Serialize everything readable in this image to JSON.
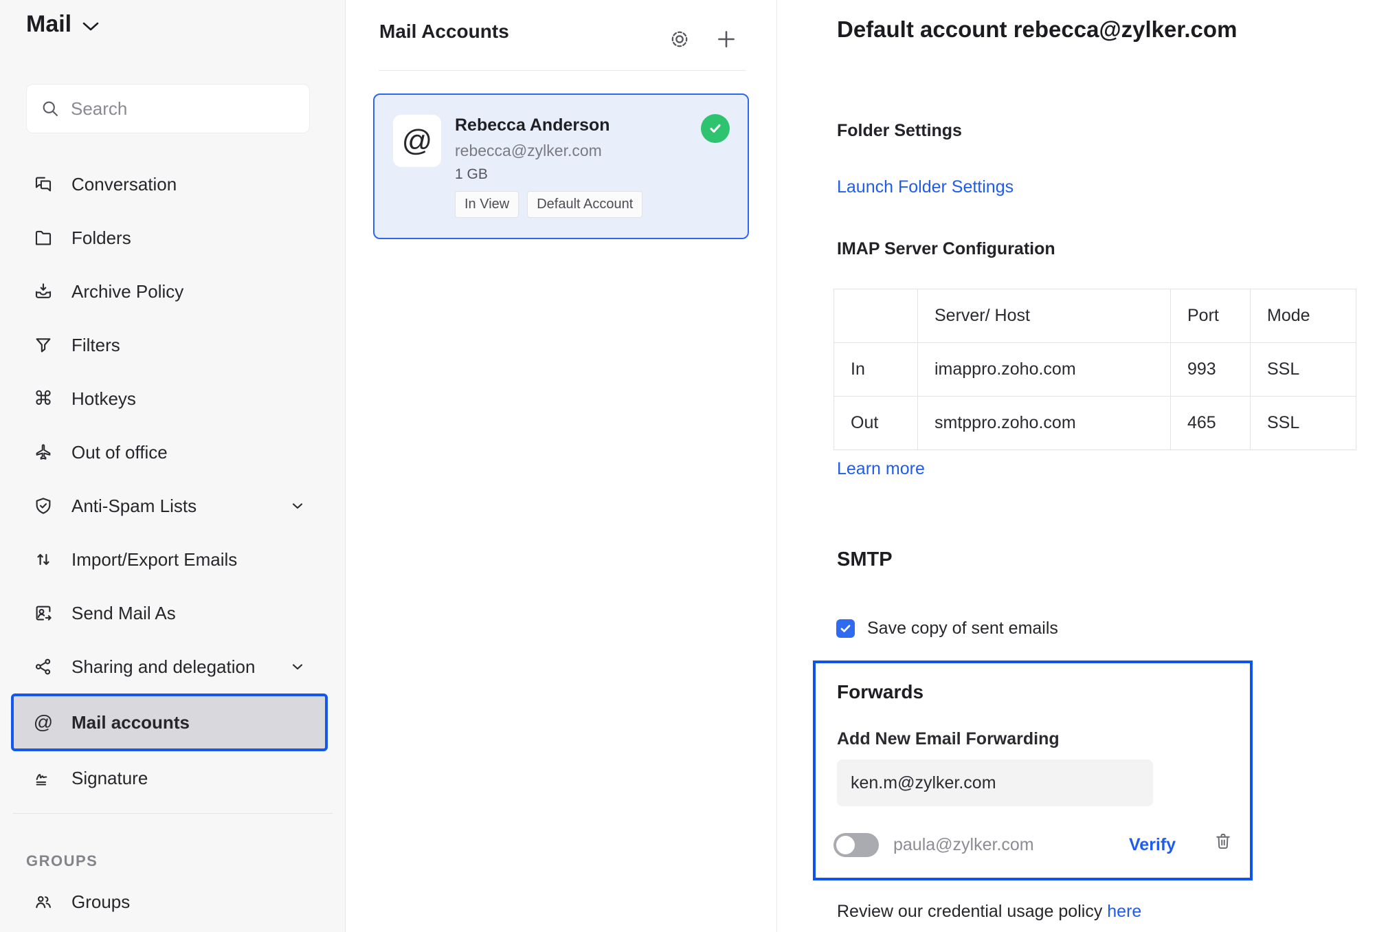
{
  "colors": {
    "accent_blue": "#1f5cec",
    "outline_blue": "#0e53ee",
    "card_border_blue": "#2e66f0",
    "success_green": "#2ec46f",
    "sidebar_bg": "#f7f7f8",
    "selected_item_bg": "#d9d9dd",
    "input_bg": "#f3f3f4"
  },
  "icons": {
    "command_glyph": "⌘",
    "at_glyph": "@"
  },
  "sidebar": {
    "app_title": "Mail",
    "search_placeholder": "Search",
    "items": [
      {
        "label": "Conversation",
        "icon": "chat-icon"
      },
      {
        "label": "Folders",
        "icon": "folder-icon"
      },
      {
        "label": "Archive Policy",
        "icon": "archive-icon"
      },
      {
        "label": "Filters",
        "icon": "funnel-icon"
      },
      {
        "label": "Hotkeys",
        "icon": "command-icon"
      },
      {
        "label": "Out of office",
        "icon": "airplane-icon"
      },
      {
        "label": "Anti-Spam Lists",
        "icon": "shield-check-icon",
        "expandable": true
      },
      {
        "label": "Import/Export Emails",
        "icon": "arrows-up-down-icon"
      },
      {
        "label": "Send Mail As",
        "icon": "send-as-icon"
      },
      {
        "label": "Sharing and delegation",
        "icon": "share-icon",
        "expandable": true
      },
      {
        "label": "Mail accounts",
        "icon": "at-icon",
        "selected": true
      },
      {
        "label": "Signature",
        "icon": "signature-icon"
      }
    ],
    "groups_section": {
      "label": "GROUPS",
      "items": [
        {
          "label": "Groups",
          "icon": "people-icon"
        }
      ]
    }
  },
  "accounts_panel": {
    "title": "Mail Accounts",
    "account_card": {
      "name": "Rebecca Anderson",
      "email": "rebecca@zylker.com",
      "storage": "1 GB",
      "badges": [
        "In View",
        "Default Account"
      ],
      "avatar_glyph": "@",
      "status": "verified"
    }
  },
  "details_panel": {
    "title": "Default account rebecca@zylker.com",
    "folder_settings": {
      "heading": "Folder Settings",
      "link": "Launch Folder Settings"
    },
    "imap": {
      "heading": "IMAP Server Configuration",
      "table": {
        "headers": [
          "",
          "Server/ Host",
          "Port",
          "Mode"
        ],
        "rows": [
          {
            "dir": "In",
            "host": "imappro.zoho.com",
            "port": "993",
            "mode": "SSL"
          },
          {
            "dir": "Out",
            "host": "smtppro.zoho.com",
            "port": "465",
            "mode": "SSL"
          }
        ]
      },
      "link": "Learn more"
    },
    "smtp": {
      "heading": "SMTP",
      "checkbox_label": "Save copy of sent emails",
      "checked": true
    },
    "forwards": {
      "heading": "Forwards",
      "add_label": "Add New Email Forwarding",
      "input_value": "ken.m@zylker.com",
      "pending": {
        "email": "paula@zylker.com",
        "action": "Verify",
        "toggle_on": false
      }
    },
    "policy_note": {
      "text": "Review our credential usage policy ",
      "link": "here"
    }
  }
}
